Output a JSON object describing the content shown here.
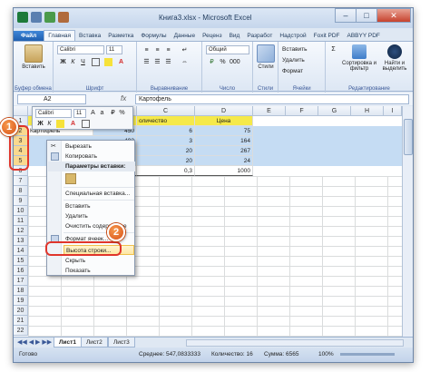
{
  "window": {
    "title": "Книга3.xlsx - Microsoft Excel",
    "controls": [
      "–",
      "□",
      "✕"
    ]
  },
  "tabs": [
    "Файл",
    "Главная",
    "Вставка",
    "Разметка",
    "Формулы",
    "Данные",
    "Реценз",
    "Вид",
    "Разработ",
    "Надстрой",
    "Foxit PDF",
    "ABBYY PDF"
  ],
  "ribbon": {
    "paste": "Вставить",
    "font_name": "Calibri",
    "font_size": "11",
    "number_format": "Общий",
    "insert": "Вставить",
    "delete": "Удалить",
    "format": "Формат",
    "sort_filter": "Сортировка и фильтр",
    "find_select": "Найти и выделить",
    "groups": {
      "clipboard": "Буфер обмена",
      "font": "Шрифт",
      "alignment": "Выравнивание",
      "number": "Число",
      "styles": "Стили",
      "cells": "Ячейки",
      "editing": "Редактирование"
    },
    "styles_label": "Стили"
  },
  "formula_bar": {
    "name_box": "A2",
    "fx": "fx",
    "content": "Картофель"
  },
  "columns": [
    "A",
    "B",
    "C",
    "D",
    "E",
    "F",
    "G",
    "H",
    "I"
  ],
  "rows": [
    "1",
    "2",
    "3",
    "4",
    "5",
    "6",
    "7",
    "8",
    "9",
    "10",
    "11",
    "12",
    "13",
    "14",
    "15",
    "16",
    "17",
    "18",
    "19",
    "20",
    "21",
    "22"
  ],
  "cells": {
    "c1": "оличество",
    "d1": "Цена",
    "b2": "450",
    "c2": "6",
    "d2": "75",
    "b3": "492",
    "c3": "3",
    "d3": "164",
    "b4": "5340",
    "c4": "20",
    "d4": "267",
    "b5": "480",
    "c5": "20",
    "d5": "24",
    "a2": "Картофель",
    "b6": "300",
    "c6": "0,3",
    "d6": "1000"
  },
  "mini_toolbar": {
    "font": "Calibri",
    "size": "11"
  },
  "context_menu": {
    "cut": "Вырезать",
    "copy": "Копировать",
    "paste_options": "Параметры вставки:",
    "paste_special": "Специальная вставка...",
    "insert": "Вставить",
    "delete": "Удалить",
    "clear": "Очистить содержимое",
    "format_cells": "Формат ячеек...",
    "row_height": "Высота строки...",
    "hide": "Скрыть",
    "show": "Показать"
  },
  "sheets": [
    "Лист1",
    "Лист2",
    "Лист3"
  ],
  "status": {
    "ready": "Готово",
    "average": "Среднее: 547,0833333",
    "count": "Количество: 16",
    "sum": "Сумма: 6565",
    "zoom": "100%"
  },
  "annotations": [
    "1",
    "2"
  ],
  "colors": {
    "selection": "#c5dcf3",
    "header_yellow": "#f5e94a",
    "highlight_orange": "#e0352b",
    "badge": "#e8681f"
  }
}
